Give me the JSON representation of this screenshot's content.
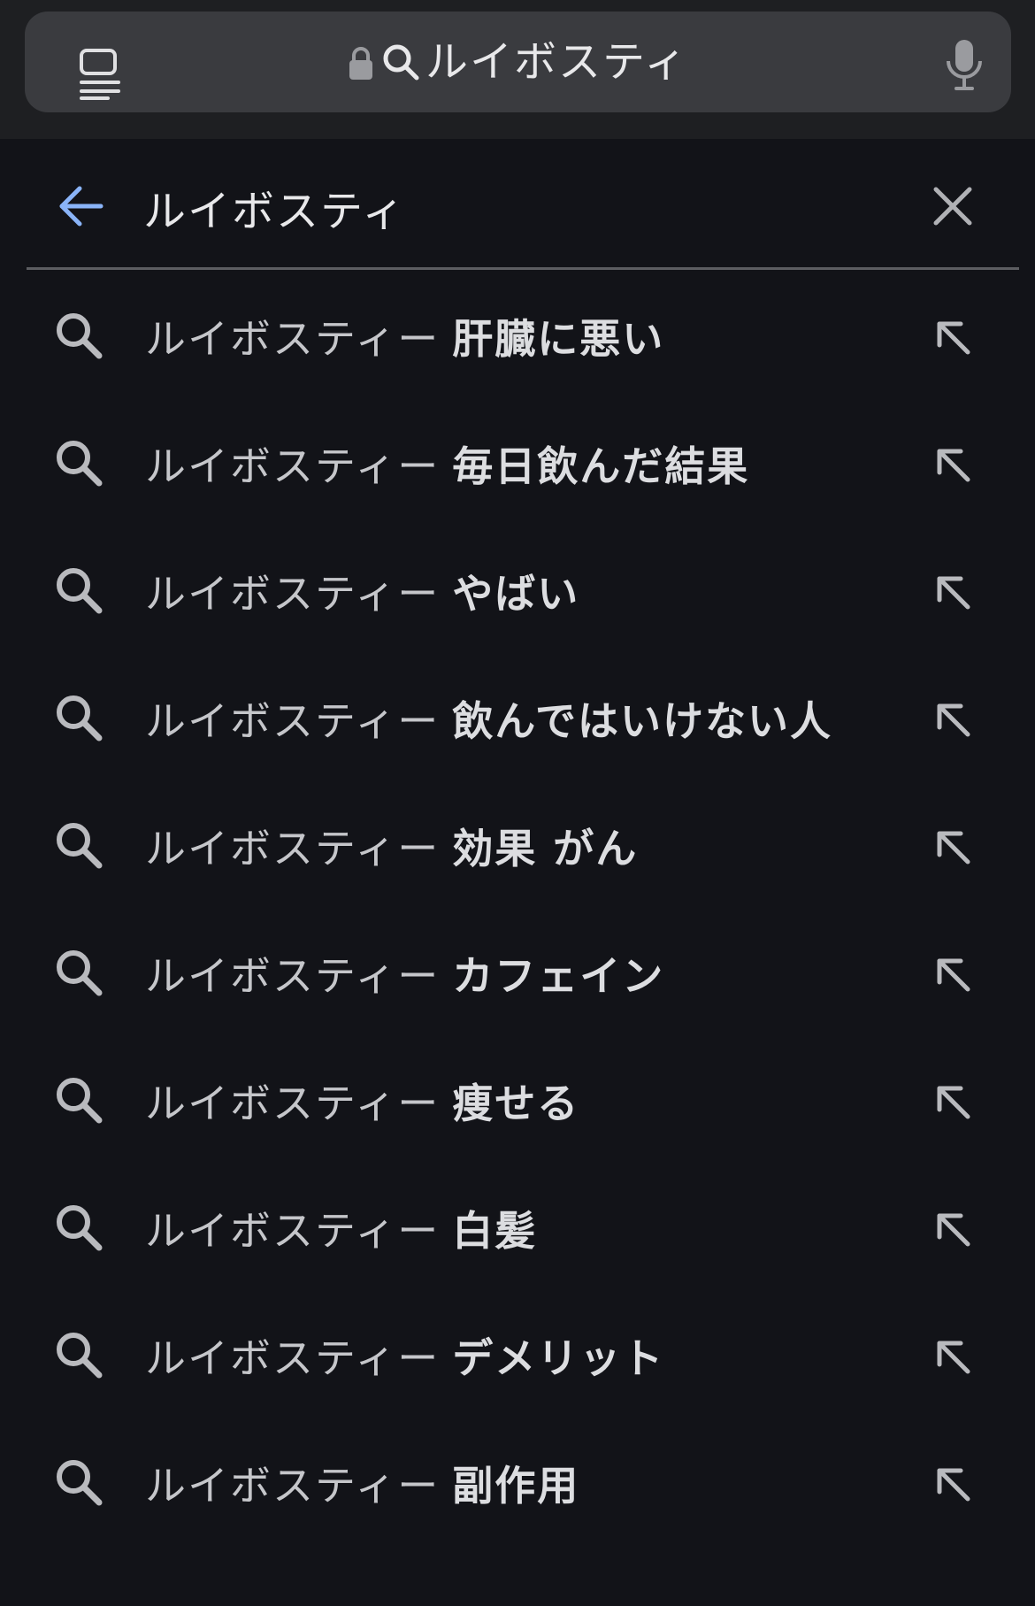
{
  "browser": {
    "url_text": "ルイボスティ"
  },
  "search": {
    "query": "ルイボスティ"
  },
  "suggestions": [
    {
      "prefix": "ルイボスティー",
      "suffix": "肝臓に悪い"
    },
    {
      "prefix": "ルイボスティー",
      "suffix": "毎日飲んだ結果"
    },
    {
      "prefix": "ルイボスティー",
      "suffix": "やばい"
    },
    {
      "prefix": "ルイボスティー",
      "suffix": "飲んではいけない人"
    },
    {
      "prefix": "ルイボスティー",
      "suffix": "効果 がん"
    },
    {
      "prefix": "ルイボスティー",
      "suffix": "カフェイン"
    },
    {
      "prefix": "ルイボスティー",
      "suffix": "痩せる"
    },
    {
      "prefix": "ルイボスティー",
      "suffix": "白髪"
    },
    {
      "prefix": "ルイボスティー",
      "suffix": "デメリット"
    },
    {
      "prefix": "ルイボスティー",
      "suffix": "副作用"
    }
  ],
  "colors": {
    "background": "#121318",
    "accent": "#8ab4f8"
  }
}
